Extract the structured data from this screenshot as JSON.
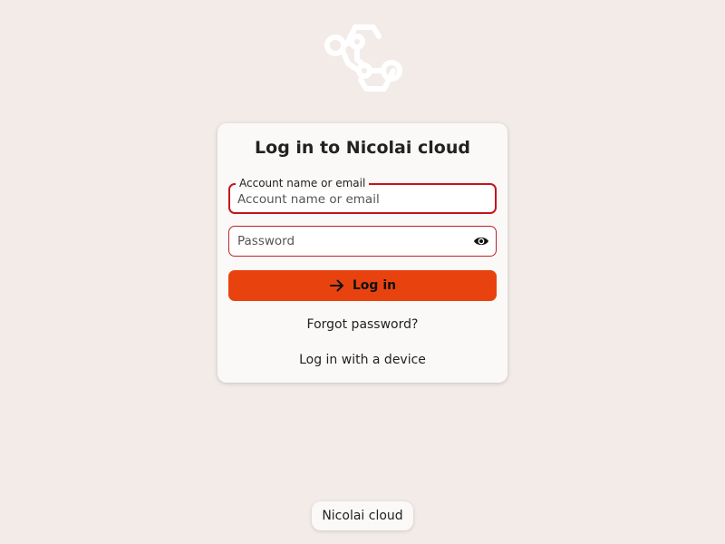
{
  "logo": {
    "icon": "nicolai-cloud-logo-icon"
  },
  "login": {
    "title": "Log in to Nicolai cloud",
    "username_label": "Account name or email",
    "username_placeholder": "Account name or email",
    "username_value": "",
    "password_placeholder": "Password",
    "password_value": "",
    "password_toggle_icon": "eye-icon",
    "submit_label": "Log in",
    "submit_icon": "arrow-right-icon",
    "forgot_password": "Forgot password?",
    "device_login": "Log in with a device"
  },
  "footer": {
    "label": "Nicolai cloud"
  },
  "colors": {
    "background": "#f2ebe7",
    "accent": "#e8430f",
    "field_border": "#c4161c",
    "card": "#fbf9f8"
  }
}
